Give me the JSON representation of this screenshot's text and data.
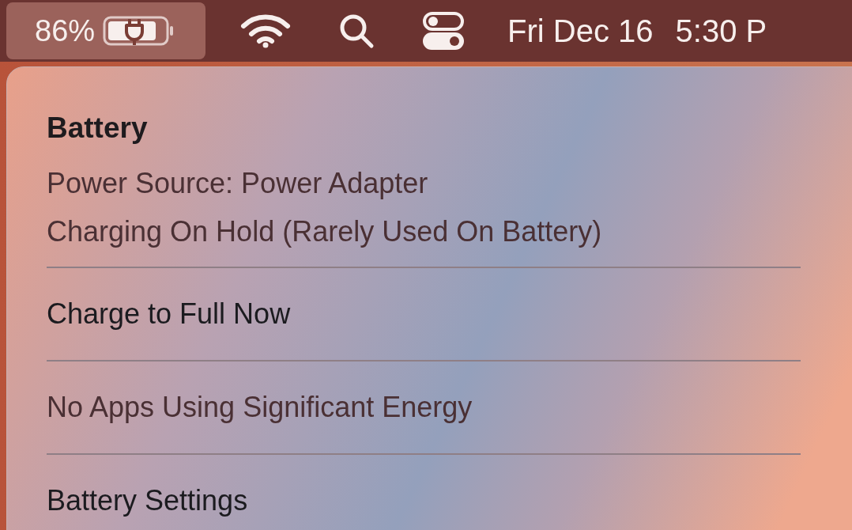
{
  "menu_bar": {
    "items": [
      {
        "kind": "battery",
        "text": "86%",
        "selected": true
      },
      {
        "kind": "wifi",
        "selected": false
      },
      {
        "kind": "search",
        "selected": false
      },
      {
        "kind": "control_center",
        "selected": false
      }
    ],
    "date": "Fri Dec 16",
    "time": "5:30 P"
  },
  "menu": {
    "title": "Battery",
    "sections": [
      [
        {
          "text": "Power Source: Power Adapter",
          "disabled": true
        },
        {
          "text": "Charging On Hold (Rarely Used On Battery)",
          "disabled": true
        }
      ],
      [
        {
          "text": "Charge to Full Now",
          "disabled": false
        }
      ],
      [
        {
          "text": "No Apps Using Significant Energy",
          "disabled": true
        }
      ],
      [
        {
          "text": "Battery Settings",
          "disabled": false
        }
      ]
    ]
  }
}
